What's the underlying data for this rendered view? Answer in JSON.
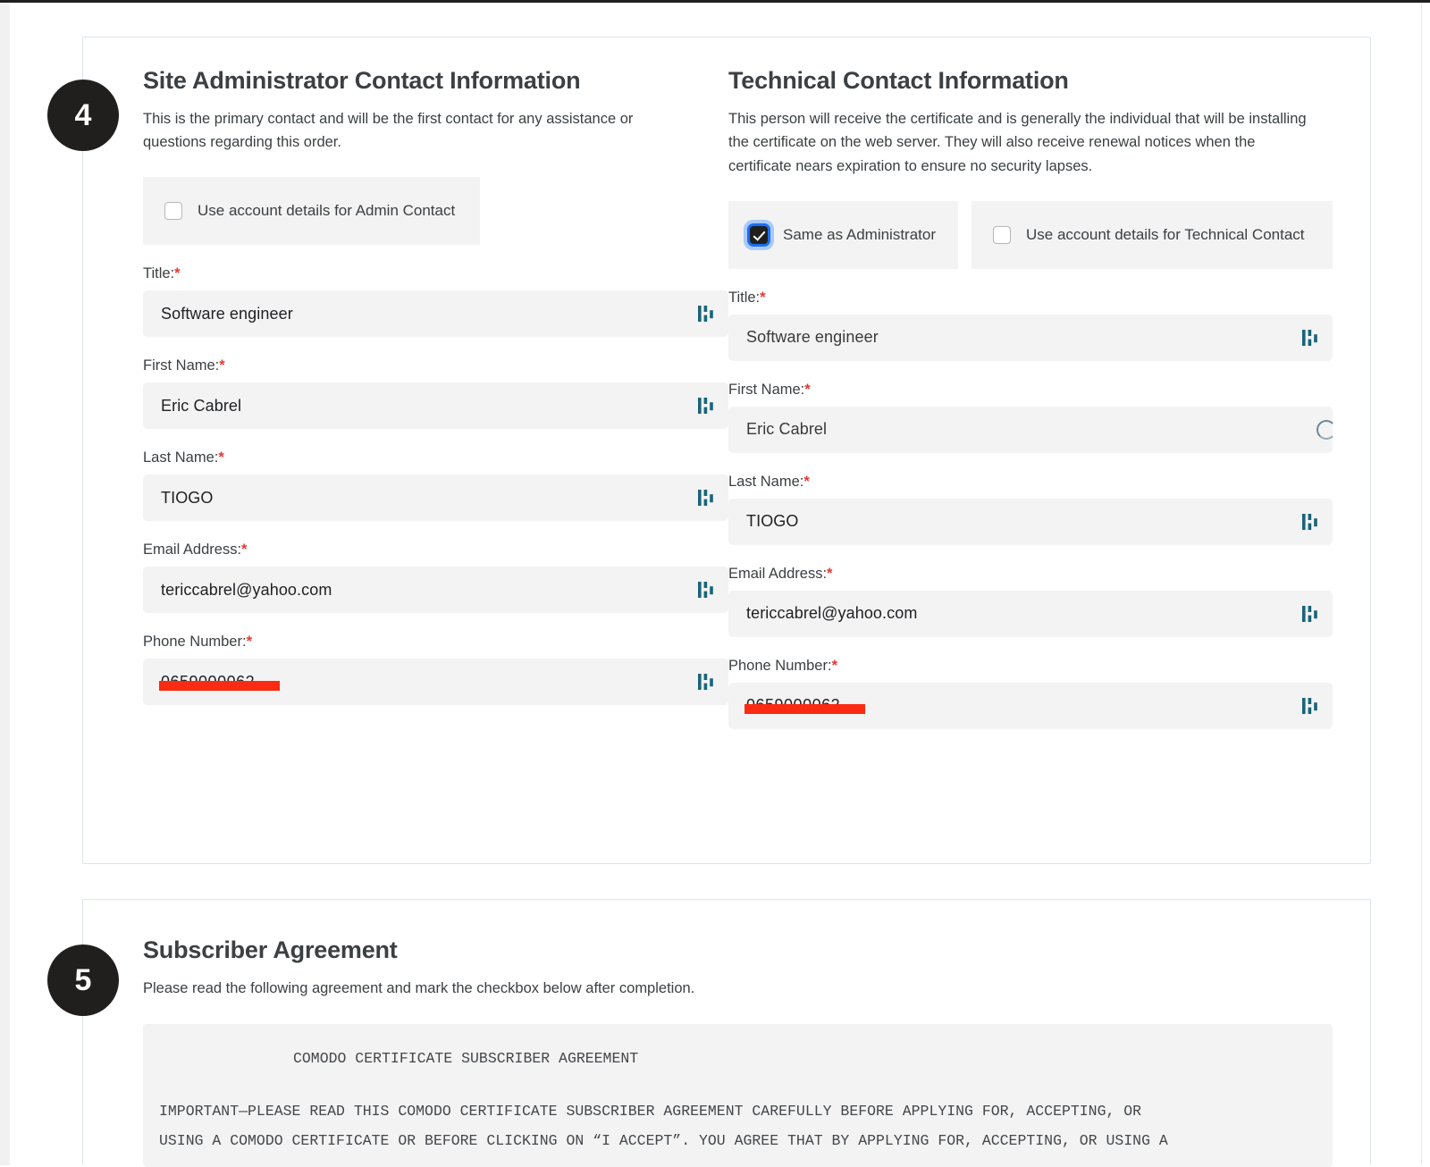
{
  "steps": {
    "contacts": {
      "number": "4"
    },
    "agreement": {
      "number": "5"
    }
  },
  "admin": {
    "title": "Site Administrator Contact Information",
    "description": "This is the primary contact and will be the first contact for any assistance or questions regarding this order.",
    "use_account_checkbox": {
      "label": "Use account details for Admin Contact",
      "checked": false
    },
    "fields": {
      "title": {
        "label": "Title:",
        "required": "*",
        "value": "Software engineer",
        "icon": "password-manager-icon"
      },
      "first_name": {
        "label": "First Name:",
        "required": "*",
        "value": "Eric Cabrel",
        "icon": "password-manager-icon"
      },
      "last_name": {
        "label": "Last Name:",
        "required": "*",
        "value": "TIOGO",
        "icon": "password-manager-icon"
      },
      "email": {
        "label": "Email Address:",
        "required": "*",
        "value": "tericcabrel@yahoo.com",
        "icon": "password-manager-icon"
      },
      "phone": {
        "label": "Phone Number:",
        "required": "*",
        "value": "0659000062",
        "redacted": true,
        "icon": "password-manager-icon"
      }
    }
  },
  "technical": {
    "title": "Technical Contact Information",
    "description": "This person will receive the certificate and is generally the individual that will be installing the certificate on the web server. They will also receive renewal notices when the certificate nears expiration to ensure no security lapses.",
    "same_as_admin_checkbox": {
      "label": "Same as Administrator",
      "checked": true,
      "focused": true
    },
    "use_account_checkbox": {
      "label": "Use account details for Technical Contact",
      "checked": false
    },
    "fields": {
      "title": {
        "label": "Title:",
        "required": "*",
        "value": "Software engineer",
        "icon": "password-manager-icon"
      },
      "first_name": {
        "label": "First Name:",
        "required": "*",
        "value": "Eric Cabrel",
        "icon": "loading-spinner-icon"
      },
      "last_name": {
        "label": "Last Name:",
        "required": "*",
        "value": "TIOGO",
        "icon": "password-manager-icon"
      },
      "email": {
        "label": "Email Address:",
        "required": "*",
        "value": "tericcabrel@yahoo.com",
        "icon": "password-manager-icon"
      },
      "phone": {
        "label": "Phone Number:",
        "required": "*",
        "value": "0659000062",
        "redacted": true,
        "icon": "password-manager-icon"
      }
    }
  },
  "agreement": {
    "title": "Subscriber Agreement",
    "description": "Please read the following agreement and mark the checkbox below after completion.",
    "document_title": "COMODO CERTIFICATE SUBSCRIBER AGREEMENT",
    "body_lines": [
      "IMPORTANT—PLEASE READ THIS COMODO CERTIFICATE SUBSCRIBER AGREEMENT CAREFULLY BEFORE APPLYING FOR, ACCEPTING, OR",
      "USING A COMODO CERTIFICATE OR BEFORE CLICKING ON “I ACCEPT”. YOU AGREE THAT BY APPLYING FOR, ACCEPTING, OR USING A"
    ]
  },
  "colors": {
    "accent_red": "#e53935",
    "redaction": "#fb2a12",
    "badge_bg": "#211f1e",
    "field_bg": "#f3f3f3",
    "focus_blue": "#1b6ef3",
    "pm_icon_teal": "#17657a"
  }
}
